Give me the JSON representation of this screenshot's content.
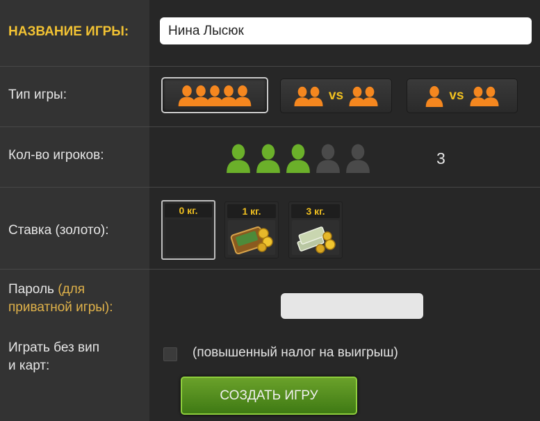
{
  "form": {
    "game_name_label": "НАЗВАНИЕ ИГРЫ:",
    "game_name_value": "Нина Лысюк",
    "game_type_label": "Тип игры:",
    "game_types": [
      {
        "id": "all",
        "selected": true
      },
      {
        "id": "team-vs-team",
        "vs": "vs",
        "selected": false
      },
      {
        "id": "one-vs-team",
        "vs": "vs",
        "selected": false
      }
    ],
    "players_label": "Кол-во игроков:",
    "players_max": 5,
    "players_selected": 3,
    "players_count_text": "3",
    "stake_label": "Ставка (золото):",
    "stakes": [
      {
        "title": "0 кг.",
        "selected": true
      },
      {
        "title": "1 кг.",
        "selected": false
      },
      {
        "title": "3 кг.",
        "selected": false
      }
    ],
    "password_label_main": "Пароль",
    "password_label_hint_1": "(для",
    "password_label_hint_2": "приватной игры):",
    "password_value": "",
    "no_vip_label_1": "Играть без вип",
    "no_vip_label_2": "и карт:",
    "no_vip_checked": false,
    "no_vip_hint": "(повышенный налог на выигрыш)",
    "create_button_label": "СОЗДАТЬ ИГРУ"
  },
  "colors": {
    "gold": "#f2c233",
    "orange_person": "#f5871f",
    "green_person": "#6bb02a",
    "gray_person": "#4a4a4a",
    "button_green": "#4f8a1c"
  }
}
